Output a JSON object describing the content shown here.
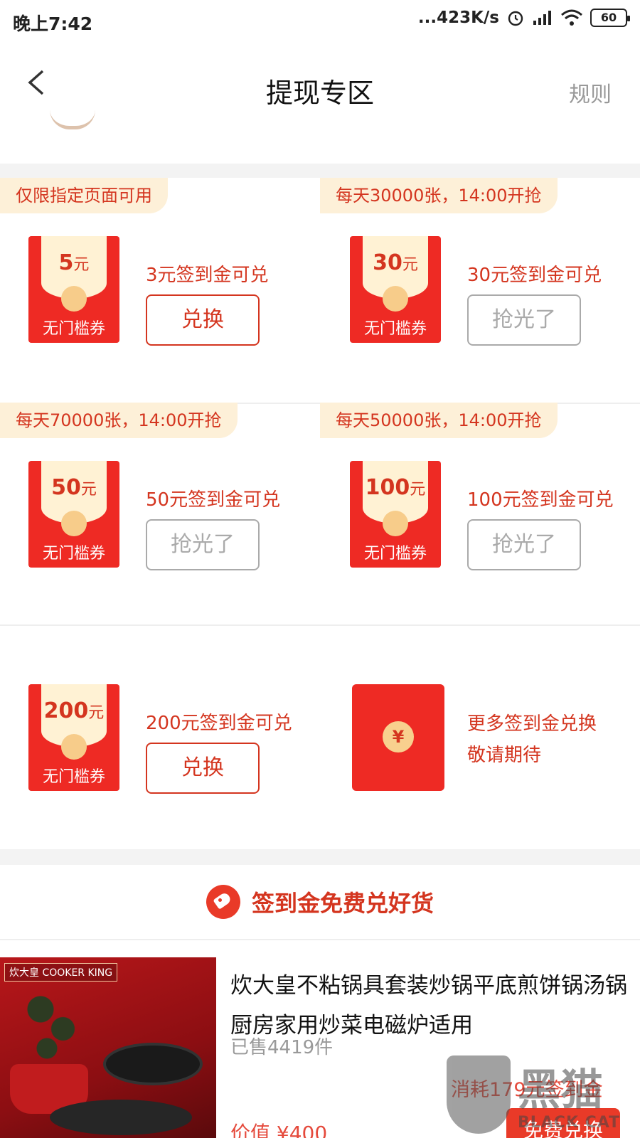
{
  "status_bar": {
    "time": "晚上7:42",
    "network_speed": "...423K/s",
    "battery": "60"
  },
  "nav": {
    "title": "提现专区",
    "rule": "规则"
  },
  "coupons": [
    {
      "tag": "仅限指定页面可用",
      "amount": "5",
      "unit": "元",
      "label": "无门槛券",
      "desc": "3元签到金可兑",
      "button": "兑换",
      "state": "active"
    },
    {
      "tag": "每天30000张，14:00开抢",
      "amount": "30",
      "unit": "元",
      "label": "无门槛券",
      "desc": "30元签到金可兑",
      "button": "抢光了",
      "state": "disabled"
    },
    {
      "tag": "每天70000张，14:00开抢",
      "amount": "50",
      "unit": "元",
      "label": "无门槛券",
      "desc": "50元签到金可兑",
      "button": "抢光了",
      "state": "disabled"
    },
    {
      "tag": "每天50000张，14:00开抢",
      "amount": "100",
      "unit": "元",
      "label": "无门槛券",
      "desc": "100元签到金可兑",
      "button": "抢光了",
      "state": "disabled"
    },
    {
      "tag": "",
      "amount": "200",
      "unit": "元",
      "label": "无门槛券",
      "desc": "200元签到金可兑",
      "button": "兑换",
      "state": "active"
    }
  ],
  "more": {
    "coin": "¥",
    "line1": "更多签到金兑换",
    "line2": "敬请期待"
  },
  "goods_section": {
    "title": "签到金免费兑好货"
  },
  "product": {
    "brand": "炊大皇 COOKER KING",
    "title": "炊大皇不粘锅具套装炒锅平底煎饼锅汤锅厨房家用炒菜电磁炉适用",
    "sold": "已售4419件",
    "consume": "消耗179元签到金",
    "value": "价值 ¥400",
    "button": "免费兑换"
  },
  "watermark": {
    "text": "黑猫",
    "sub": "BLACK CAT"
  },
  "colors": {
    "accent": "#d4351f",
    "coupon_red": "#ee2a24",
    "tag_bg": "#fdf0d8"
  }
}
